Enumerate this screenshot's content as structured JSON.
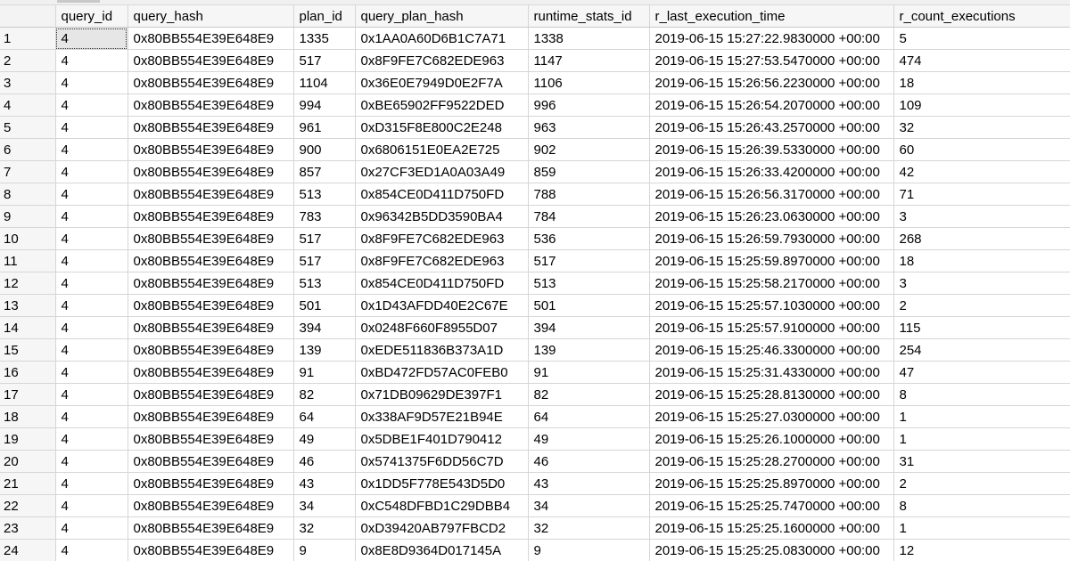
{
  "grid": {
    "columns": [
      "",
      "query_id",
      "query_hash",
      "plan_id",
      "query_plan_hash",
      "runtime_stats_id",
      "r_last_execution_time",
      "r_count_executions"
    ],
    "rows": [
      [
        "1",
        "4",
        "0x80BB554E39E648E9",
        "1335",
        "0x1AA0A60D6B1C7A71",
        "1338",
        "2019-06-15 15:27:22.9830000 +00:00",
        "5"
      ],
      [
        "2",
        "4",
        "0x80BB554E39E648E9",
        "517",
        "0x8F9FE7C682EDE963",
        "1147",
        "2019-06-15 15:27:53.5470000 +00:00",
        "474"
      ],
      [
        "3",
        "4",
        "0x80BB554E39E648E9",
        "1104",
        "0x36E0E7949D0E2F7A",
        "1106",
        "2019-06-15 15:26:56.2230000 +00:00",
        "18"
      ],
      [
        "4",
        "4",
        "0x80BB554E39E648E9",
        "994",
        "0xBE65902FF9522DED",
        "996",
        "2019-06-15 15:26:54.2070000 +00:00",
        "109"
      ],
      [
        "5",
        "4",
        "0x80BB554E39E648E9",
        "961",
        "0xD315F8E800C2E248",
        "963",
        "2019-06-15 15:26:43.2570000 +00:00",
        "32"
      ],
      [
        "6",
        "4",
        "0x80BB554E39E648E9",
        "900",
        "0x6806151E0EA2E725",
        "902",
        "2019-06-15 15:26:39.5330000 +00:00",
        "60"
      ],
      [
        "7",
        "4",
        "0x80BB554E39E648E9",
        "857",
        "0x27CF3ED1A0A03A49",
        "859",
        "2019-06-15 15:26:33.4200000 +00:00",
        "42"
      ],
      [
        "8",
        "4",
        "0x80BB554E39E648E9",
        "513",
        "0x854CE0D411D750FD",
        "788",
        "2019-06-15 15:26:56.3170000 +00:00",
        "71"
      ],
      [
        "9",
        "4",
        "0x80BB554E39E648E9",
        "783",
        "0x96342B5DD3590BA4",
        "784",
        "2019-06-15 15:26:23.0630000 +00:00",
        "3"
      ],
      [
        "10",
        "4",
        "0x80BB554E39E648E9",
        "517",
        "0x8F9FE7C682EDE963",
        "536",
        "2019-06-15 15:26:59.7930000 +00:00",
        "268"
      ],
      [
        "11",
        "4",
        "0x80BB554E39E648E9",
        "517",
        "0x8F9FE7C682EDE963",
        "517",
        "2019-06-15 15:25:59.8970000 +00:00",
        "18"
      ],
      [
        "12",
        "4",
        "0x80BB554E39E648E9",
        "513",
        "0x854CE0D411D750FD",
        "513",
        "2019-06-15 15:25:58.2170000 +00:00",
        "3"
      ],
      [
        "13",
        "4",
        "0x80BB554E39E648E9",
        "501",
        "0x1D43AFDD40E2C67E",
        "501",
        "2019-06-15 15:25:57.1030000 +00:00",
        "2"
      ],
      [
        "14",
        "4",
        "0x80BB554E39E648E9",
        "394",
        "0x0248F660F8955D07",
        "394",
        "2019-06-15 15:25:57.9100000 +00:00",
        "115"
      ],
      [
        "15",
        "4",
        "0x80BB554E39E648E9",
        "139",
        "0xEDE511836B373A1D",
        "139",
        "2019-06-15 15:25:46.3300000 +00:00",
        "254"
      ],
      [
        "16",
        "4",
        "0x80BB554E39E648E9",
        "91",
        "0xBD472FD57AC0FEB0",
        "91",
        "2019-06-15 15:25:31.4330000 +00:00",
        "47"
      ],
      [
        "17",
        "4",
        "0x80BB554E39E648E9",
        "82",
        "0x71DB09629DE397F1",
        "82",
        "2019-06-15 15:25:28.8130000 +00:00",
        "8"
      ],
      [
        "18",
        "4",
        "0x80BB554E39E648E9",
        "64",
        "0x338AF9D57E21B94E",
        "64",
        "2019-06-15 15:25:27.0300000 +00:00",
        "1"
      ],
      [
        "19",
        "4",
        "0x80BB554E39E648E9",
        "49",
        "0x5DBE1F401D790412",
        "49",
        "2019-06-15 15:25:26.1000000 +00:00",
        "1"
      ],
      [
        "20",
        "4",
        "0x80BB554E39E648E9",
        "46",
        "0x5741375F6DD56C7D",
        "46",
        "2019-06-15 15:25:28.2700000 +00:00",
        "31"
      ],
      [
        "21",
        "4",
        "0x80BB554E39E648E9",
        "43",
        "0x1DD5F778E543D5D0",
        "43",
        "2019-06-15 15:25:25.8970000 +00:00",
        "2"
      ],
      [
        "22",
        "4",
        "0x80BB554E39E648E9",
        "34",
        "0xC548DFBD1C29DBB4",
        "34",
        "2019-06-15 15:25:25.7470000 +00:00",
        "8"
      ],
      [
        "23",
        "4",
        "0x80BB554E39E648E9",
        "32",
        "0xD39420AB797FBCD2",
        "32",
        "2019-06-15 15:25:25.1600000 +00:00",
        "1"
      ],
      [
        "24",
        "4",
        "0x80BB554E39E648E9",
        "9",
        "0x8E8D9364D017145A",
        "9",
        "2019-06-15 15:25:25.0830000 +00:00",
        "12"
      ]
    ]
  }
}
